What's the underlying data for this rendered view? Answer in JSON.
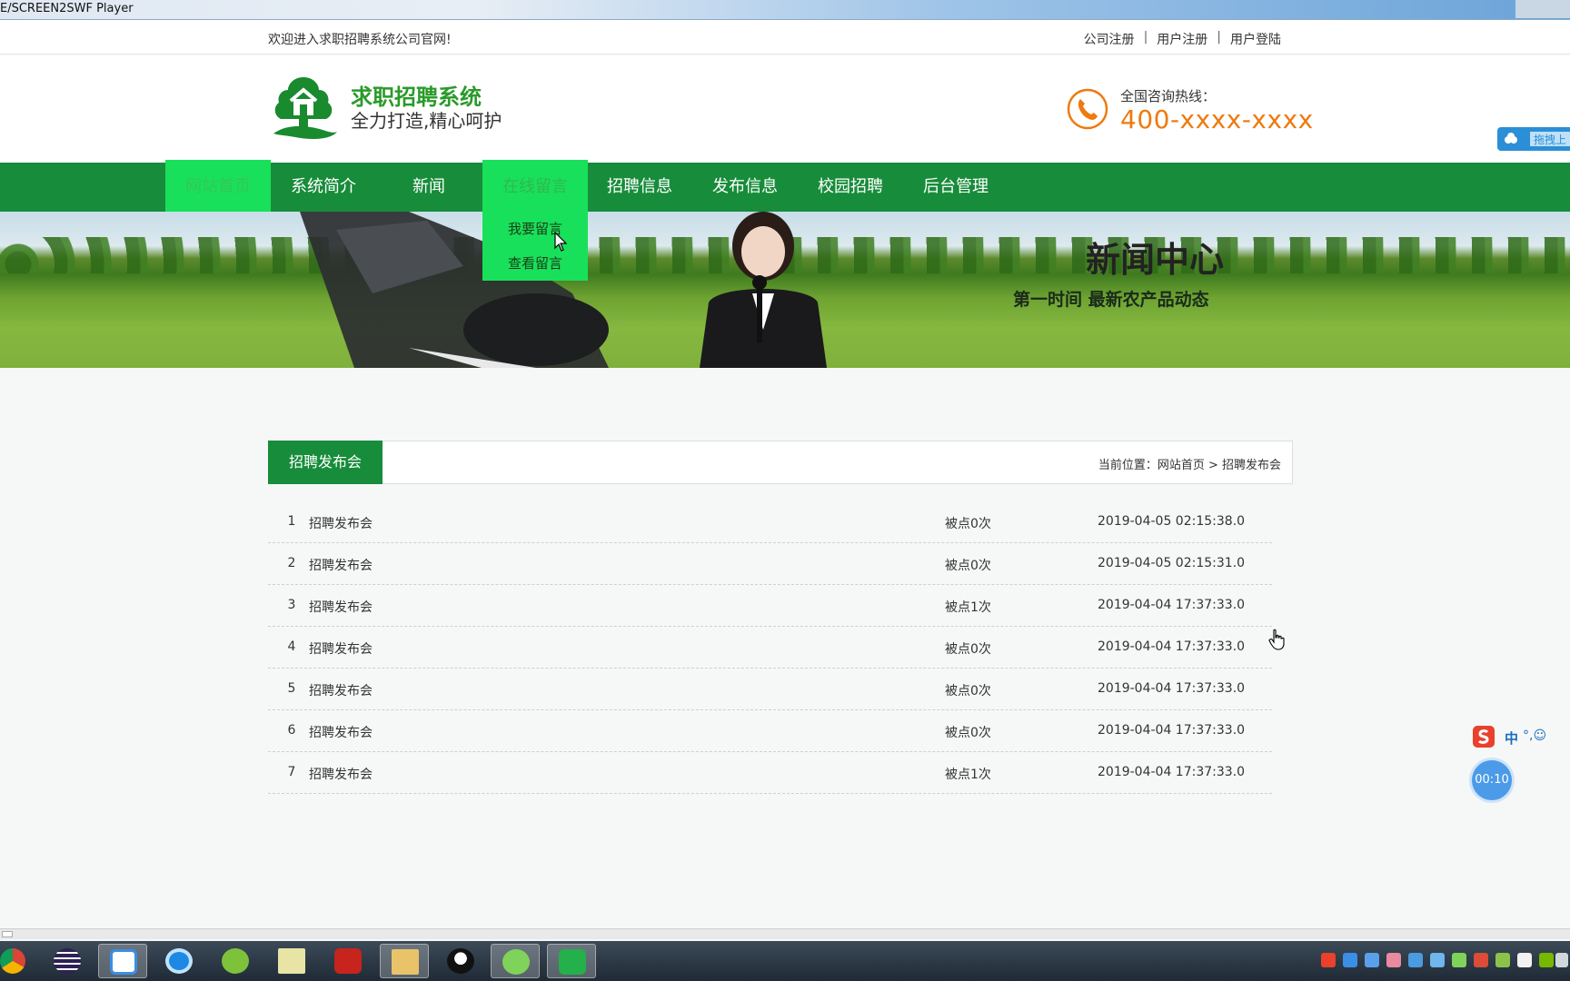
{
  "window": {
    "title": "E/SCREEN2SWF Player"
  },
  "topbar": {
    "welcome": "欢迎进入求职招聘系统公司官网!",
    "links": [
      "公司注册",
      "用户注册",
      "用户登陆"
    ],
    "separator": "|"
  },
  "header": {
    "site_title": "求职招聘系统",
    "slogan": "全力打造,精心呵护",
    "hotline_label": "全国咨询热线：",
    "hotline_number": "400-xxxx-xxxx"
  },
  "side_tab": {
    "label": "拖拽上"
  },
  "nav": {
    "items": [
      {
        "label": "网站首页",
        "state": "active"
      },
      {
        "label": "系统简介",
        "state": "normal"
      },
      {
        "label": "新闻",
        "state": "normal"
      },
      {
        "label": "在线留言",
        "state": "hover"
      },
      {
        "label": "招聘信息",
        "state": "normal"
      },
      {
        "label": "发布信息",
        "state": "normal"
      },
      {
        "label": "校园招聘",
        "state": "normal"
      },
      {
        "label": "后台管理",
        "state": "normal"
      }
    ],
    "dropdown": [
      "我要留言",
      "查看留言"
    ]
  },
  "banner": {
    "title": "新闻中心",
    "subtitle": "第一时间  最新农产品动态"
  },
  "section": {
    "tab_label": "招聘发布会",
    "breadcrumb": "当前位置：网站首页 > 招聘发布会"
  },
  "list": [
    {
      "index": "1",
      "title": "招聘发布会",
      "clicks": "被点0次",
      "date": "2019-04-05 02:15:38.0"
    },
    {
      "index": "2",
      "title": "招聘发布会",
      "clicks": "被点0次",
      "date": "2019-04-05 02:15:31.0"
    },
    {
      "index": "3",
      "title": "招聘发布会",
      "clicks": "被点1次",
      "date": "2019-04-04 17:37:33.0"
    },
    {
      "index": "4",
      "title": "招聘发布会",
      "clicks": "被点0次",
      "date": "2019-04-04 17:37:33.0"
    },
    {
      "index": "5",
      "title": "招聘发布会",
      "clicks": "被点0次",
      "date": "2019-04-04 17:37:33.0"
    },
    {
      "index": "6",
      "title": "招聘发布会",
      "clicks": "被点0次",
      "date": "2019-04-04 17:37:33.0"
    },
    {
      "index": "7",
      "title": "招聘发布会",
      "clicks": "被点1次",
      "date": "2019-04-04 17:37:33.0"
    }
  ],
  "ime": {
    "mode": "中",
    "extras": "°,☺"
  },
  "timer": {
    "text": "00:10"
  },
  "taskbar": {
    "apps": [
      "chrome-icon",
      "eclipse-icon",
      "baidu-netdisk-icon",
      "qq-browser-icon",
      "360-icon",
      "notepad-icon",
      "flash-icon",
      "explorer-icon",
      "qq-icon",
      "wechat-icon",
      "screen2swf-icon"
    ]
  },
  "colors": {
    "nav_green": "#178c3a",
    "active_green": "#19e05a",
    "hotline_orange": "#ee7a10",
    "title_green": "#2a9a2a"
  }
}
